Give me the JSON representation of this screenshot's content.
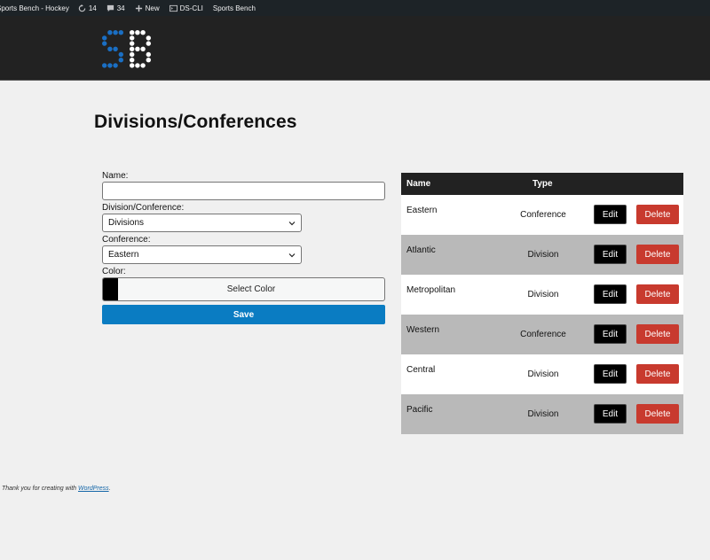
{
  "admin_bar": {
    "site_name": "Sports Bench - Hockey",
    "updates_count": "14",
    "comments_count": "34",
    "new_label": "New",
    "cli_label": "DS-CLI",
    "plugin_label": "Sports Bench"
  },
  "header": {
    "logo_icon": "sports-bench-logo"
  },
  "page": {
    "title": "Divisions/Conferences"
  },
  "form": {
    "name_label": "Name:",
    "name_value": "",
    "type_label": "Division/Conference:",
    "type_value": "Divisions",
    "conference_label": "Conference:",
    "conference_value": "Eastern",
    "color_label": "Color:",
    "color_button": "Select Color",
    "color_value": "#000000",
    "save_label": "Save"
  },
  "table": {
    "headers": {
      "name": "Name",
      "type": "Type"
    },
    "edit_label": "Edit",
    "delete_label": "Delete",
    "rows": [
      {
        "name": "Eastern",
        "type": "Conference"
      },
      {
        "name": "Atlantic",
        "type": "Division"
      },
      {
        "name": "Metropolitan",
        "type": "Division"
      },
      {
        "name": "Western",
        "type": "Conference"
      },
      {
        "name": "Central",
        "type": "Division"
      },
      {
        "name": "Pacific",
        "type": "Division"
      }
    ]
  },
  "footer": {
    "text": "Thank you for creating with",
    "link": "WordPress",
    "suffix": "."
  },
  "colors": {
    "primary_blue": "#0a7cc2",
    "delete_red": "#c83a2e",
    "logo_blue": "#1a6fc4"
  }
}
